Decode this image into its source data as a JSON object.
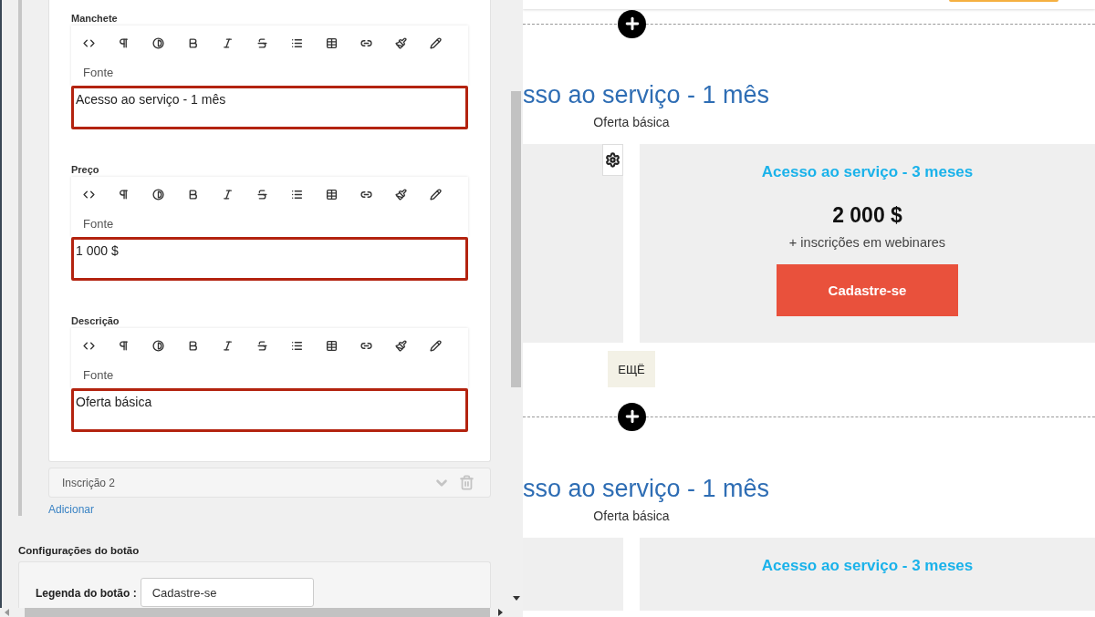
{
  "editor": {
    "fields": [
      {
        "label": "Manchete",
        "source_label": "Fonte",
        "value": "Acesso ao serviço - 1 mês",
        "highlighted": true
      },
      {
        "label": "Preço",
        "source_label": "Fonte",
        "value": "1 000 $",
        "highlighted": true
      },
      {
        "label": "Descrição",
        "source_label": "Fonte",
        "value": "Oferta básica",
        "highlighted": true
      }
    ],
    "collapsed_items": [
      {
        "title": "Inscrição 2"
      }
    ],
    "add_link": "Adicionar",
    "button_settings": {
      "title": "Configurações do botão",
      "caption_label": "Legenda do botão :",
      "caption_value": "Cadastre-se"
    }
  },
  "preview": {
    "sections": [
      {
        "heading": "sso ao serviço - 1 mês",
        "subtitle": "Oferta básica",
        "card": {
          "title": "Acesso ao serviço - 3 meses",
          "price": "2 000 $",
          "note": "+ inscrições em webinares",
          "button": "Cadastre-se"
        },
        "more_button": "ЕЩЁ"
      },
      {
        "heading": "sso ao serviço - 1 mês",
        "subtitle": "Oferta básica",
        "card": {
          "title": "Acesso ao serviço - 3 meses"
        }
      }
    ]
  }
}
